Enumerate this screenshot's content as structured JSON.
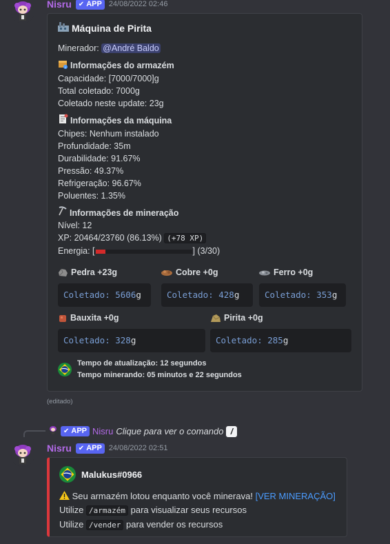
{
  "message1": {
    "author": "Nisru",
    "badge": "APP",
    "timestamp": "24/08/2022 02:46",
    "embed": {
      "title": "Máquina de Pirita",
      "miner_label": "Minerador:",
      "miner_mention": "@André Baldo",
      "storage_title": "Informações do armazém",
      "storage_lines": [
        "Capacidade: [7000/7000]g",
        "Total coletado: 7000g",
        "Coletado neste update: 23g"
      ],
      "machine_title": "Informações da máquina",
      "machine_lines": [
        "Chipes: Nenhum instalado",
        "Profundidade: 35m",
        "Durabilidade: 91.67%",
        "Pressão: 49.37%",
        "Refrigeração: 96.67%",
        "Poluentes: 1.35%"
      ],
      "mining_title": "Informações de mineração",
      "level": "Nível: 12",
      "xp": "XP: 20464/23760 (86.13%)",
      "xp_gain": "(+78 XP)",
      "energy_label": "Energia: [",
      "energy_suffix": "] (3/30)",
      "energy_fraction": 0.1,
      "resources": [
        {
          "name": "Pedra +23g",
          "value": "Coletado: 5606",
          "unit": "g",
          "icon": "rock-icon"
        },
        {
          "name": "Cobre +0g",
          "value": "Coletado: 428",
          "unit": "g",
          "icon": "copper-icon"
        },
        {
          "name": "Ferro +0g",
          "value": "Coletado: 353",
          "unit": "g",
          "icon": "iron-icon"
        },
        {
          "name": "Bauxita +0g",
          "value": "Coletado: 328",
          "unit": "g",
          "icon": "bauxite-icon"
        },
        {
          "name": "Pirita +0g",
          "value": "Coletado: 285",
          "unit": "g",
          "icon": "pyrite-icon"
        }
      ],
      "footer_line1": "Tempo de atualização: 12 segundos",
      "footer_line2": "Tempo minerando: 05 minutos e 22 segundos"
    },
    "edited": "(editado)"
  },
  "message2": {
    "reply_author": "Nisru",
    "reply_text": "Clique para ver o comando",
    "author": "Nisru",
    "badge": "APP",
    "timestamp": "24/08/2022 02:51",
    "embed": {
      "author": "Malukus#0966",
      "warning_text": "Seu armazém lotou enquanto você minerava!",
      "link_text": "[VER MINERAÇÃO]",
      "line2_prefix": "Utilize",
      "line2_cmd": "/armazém",
      "line2_suffix": "para visualizar seus recursos",
      "line3_prefix": "Utilize",
      "line3_cmd": "/vender",
      "line3_suffix": "para vender os recursos",
      "accent_color": "#da373c"
    }
  },
  "colors": {
    "background": "#323339",
    "embed_bg": "#2b2d31",
    "author": "#b36ae8",
    "badge": "#5865f2",
    "link": "#4b9cff",
    "energy": "#d42a2a"
  }
}
